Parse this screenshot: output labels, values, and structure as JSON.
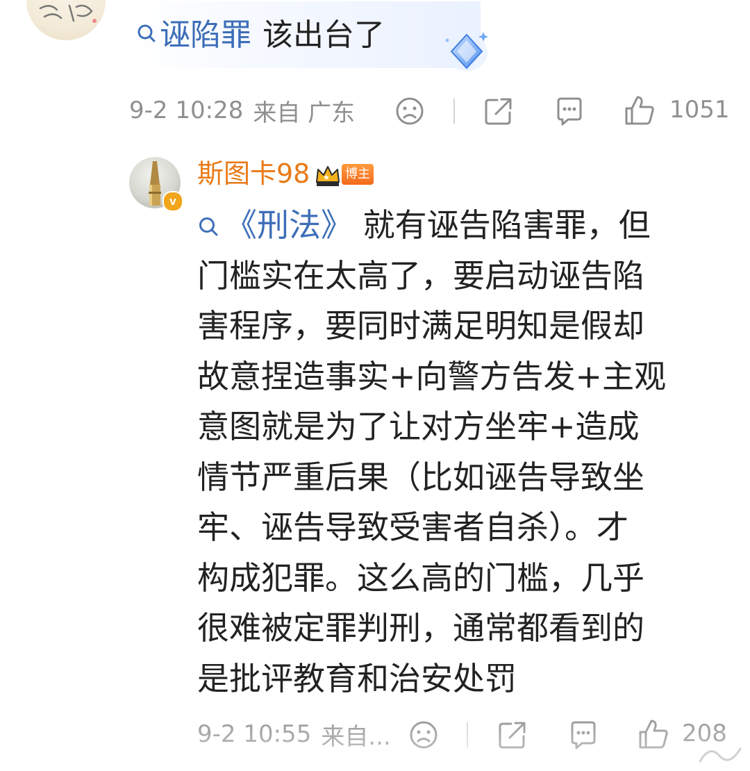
{
  "top_comment": {
    "keyword": "诬陷罪",
    "text": "该出台了",
    "meta": {
      "time": "9-2 10:28",
      "location": "来自 广东",
      "like_count": "1051"
    }
  },
  "reply": {
    "username": "斯图卡98",
    "badge_label": "博主",
    "verified_mark": "v",
    "keyword": "《刑法》",
    "lines": [
      " 就有诬告陷害罪，但",
      "门槛实在太高了，要启动诬告陷",
      "害程序，要同时满足明知是假却",
      "故意捏造事实+向警方告发+主观",
      "意图就是为了让对方坐牢+造成",
      "情节严重后果（比如诬告导致坐",
      "牢、诬告导致受害者自杀）。才",
      "构成犯罪。这么高的门槛，几乎",
      "很难被定罪判刑，通常都看到的",
      "是批评教育和治安处罚"
    ],
    "meta": {
      "time": "9-2 10:55",
      "location": "来自...",
      "like_count": "208"
    }
  },
  "icons": [
    "search-icon",
    "sad-face-icon",
    "share-icon",
    "comment-icon",
    "like-icon",
    "crown-badge-icon",
    "diamond-badge-icon",
    "verified-icon"
  ],
  "colors": {
    "keyword_link": "#3d6eb8",
    "username": "#e87a17",
    "meta_gray": "#8f8f8f",
    "verified": "#f0a51a"
  }
}
